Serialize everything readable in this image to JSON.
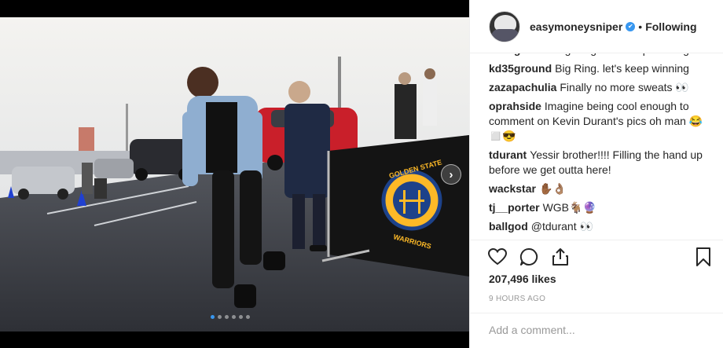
{
  "post": {
    "username": "easymoneysniper",
    "verified_mark": "✔",
    "separator": "•",
    "follow_status": "Following",
    "carousel": {
      "next_glyph": "›",
      "dot_count": 6,
      "active_index": 0
    },
    "comments": [
      {
        "user": "kd35ground",
        "text": "Big Ring. let's keep winning"
      },
      {
        "user": "kd35ground",
        "text": "Big Ring. let's keep winning"
      },
      {
        "user": "zazapachulia",
        "text": "Finally no more sweats 👀"
      },
      {
        "user": "oprahside",
        "text": "Imagine being cool enough to comment on Kevin Durant's pics oh man 😂◻️😎"
      },
      {
        "user": "tdurant",
        "text": "Yessir brother!!!! Filling the hand up before we get outta here!"
      },
      {
        "user": "wackstar",
        "text": "✋🏾👌🏽"
      },
      {
        "user": "tj__porter",
        "text": "WGB🐐🔮"
      },
      {
        "user": "ballgod",
        "text": "@tdurant 👀"
      }
    ],
    "likes": "207,496 likes",
    "time_ago": "9 HOURS AGO",
    "add_comment_placeholder": "Add a comment...",
    "icons": [
      "heart-icon",
      "comment-icon",
      "share-icon",
      "bookmark-icon"
    ],
    "banner_text": "GOLDEN STATE WARRIORS"
  }
}
